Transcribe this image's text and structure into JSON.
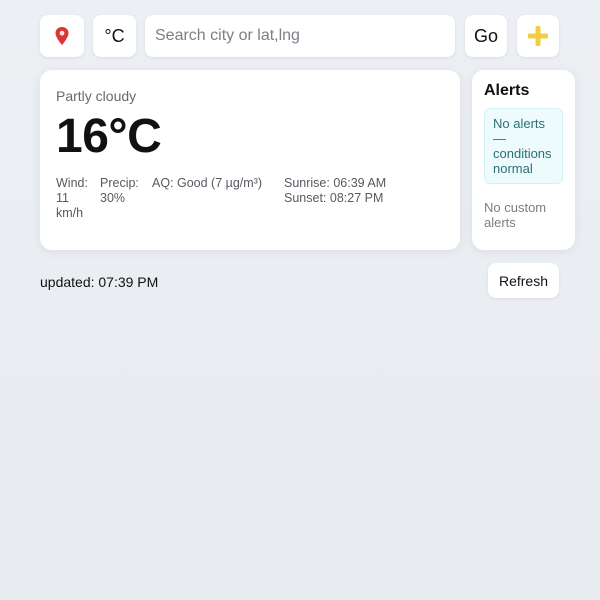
{
  "toolbar": {
    "location_icon": "location-pin-icon",
    "unit_label": "°C",
    "search_placeholder": "Search city or lat,lng",
    "search_value": "",
    "go_label": "Go",
    "add_icon": "plus-icon"
  },
  "weather": {
    "condition": "Partly cloudy",
    "temperature": "16°C",
    "wind_label": "Wind:",
    "wind_value": "11 km/h",
    "precip_label": "Precip:",
    "precip_value": "30%",
    "air_quality": "AQ: Good (7 µg/m³)",
    "sunrise": "Sunrise: 06:39 AM",
    "sunset": "Sunset: 08:27 PM"
  },
  "alerts": {
    "title": "Alerts",
    "status": "No alerts — conditions normal",
    "custom": "No custom alerts"
  },
  "footer": {
    "updated": "updated: 07:39 PM",
    "refresh_label": "Refresh"
  },
  "colors": {
    "pin": "#d93636",
    "plus": "#f3cf3f",
    "alert_bg": "#eefbfd",
    "alert_text": "#2a6f7a"
  }
}
